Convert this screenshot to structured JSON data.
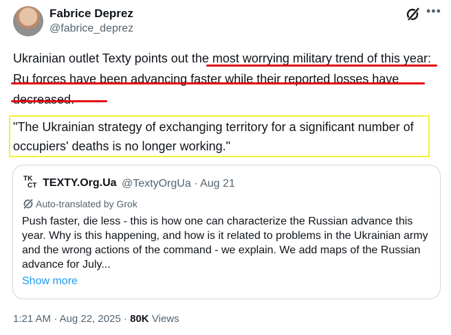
{
  "author": {
    "name": "Fabrice Deprez",
    "handle": "@fabrice_deprez"
  },
  "tweet": {
    "part1": "Ukrainian outlet Texty points out ",
    "part2": "the most worrying military trend of this year: Ru forces have been advancing faster while their reported losses have decreased",
    "part3": ".",
    "quote": "\"The Ukrainian strategy of exchanging territory for a significant number of occupiers' deaths is no longer working.\""
  },
  "quoted": {
    "logo_top": "TK",
    "logo_bottom": "CT",
    "name": "TEXTY.Org.Ua",
    "meta": "@TextyOrgUa · Aug 21",
    "translated": "Auto-translated by Grok",
    "body": "Push faster, die less - this is how one can characterize the Russian advance this year. Why is this happening, and how is it related to problems in the Ukrainian army and the wrong actions of the command - we explain. We add maps of the Russian advance for July...",
    "show_more": "Show more"
  },
  "footer": {
    "time": "1:21 AM · Aug 22, 2025 · ",
    "views_count": "80K",
    "views_label": " Views"
  },
  "colors": {
    "underline": "#e3000f",
    "quote_border": "#f2f232",
    "link": "#1d9bf0",
    "muted": "#536471"
  },
  "icons": [
    "grok-icon",
    "more-icon",
    "auto-translate-icon"
  ]
}
